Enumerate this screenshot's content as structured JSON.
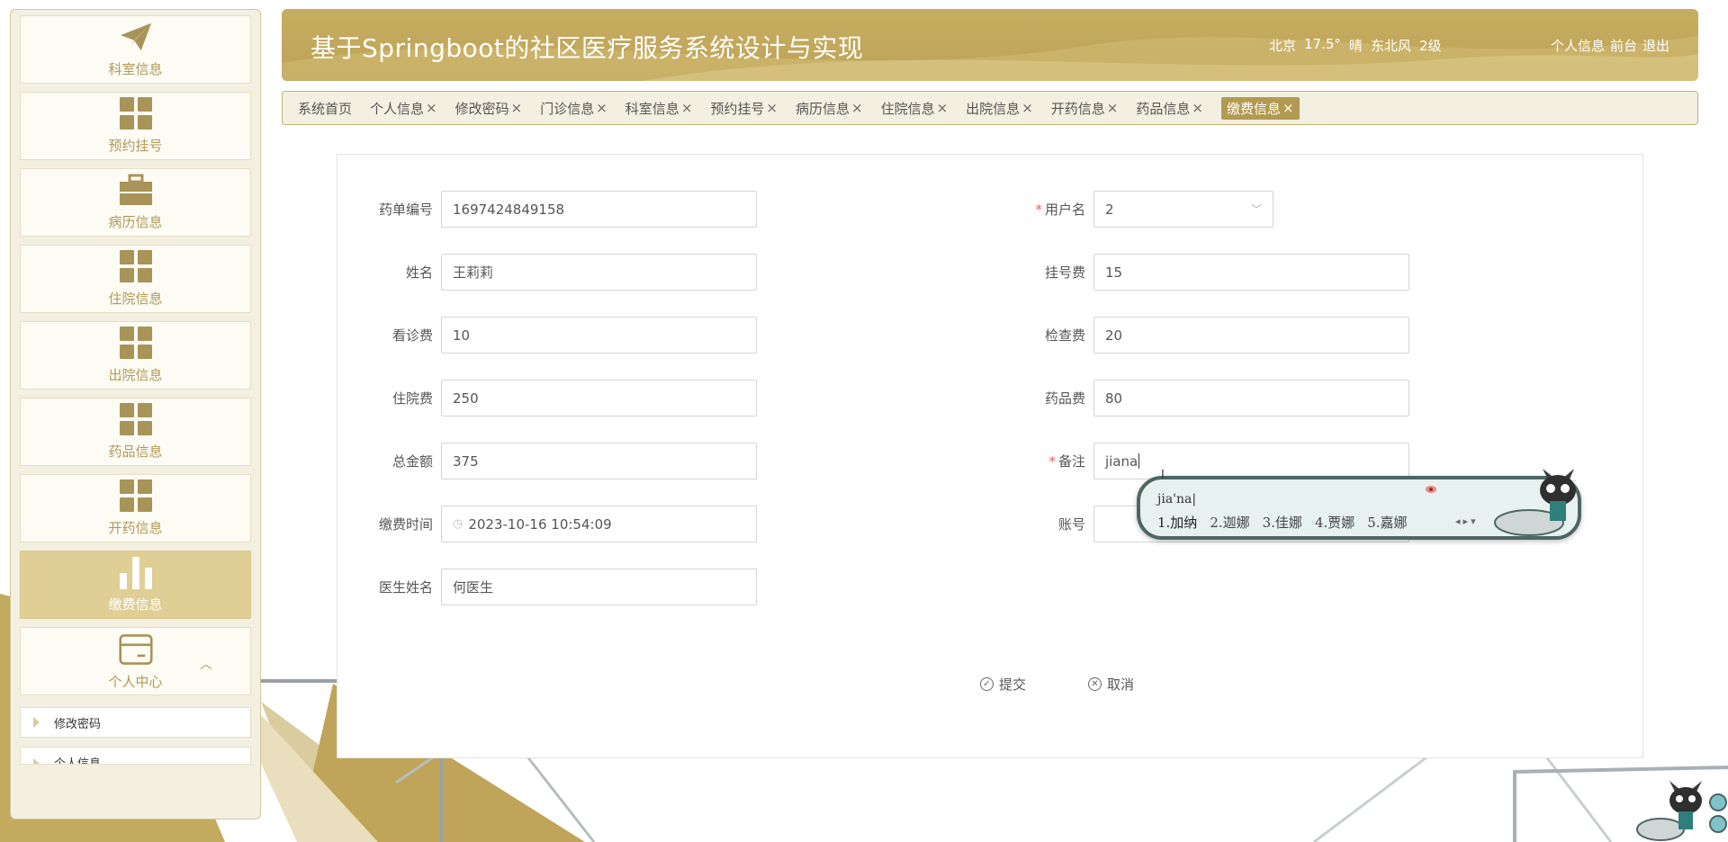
{
  "header": {
    "title": "基于Springboot的社区医疗服务系统设计与实现",
    "weather": [
      "北京",
      "17.5°",
      "晴",
      "东北风",
      "2级"
    ],
    "links": [
      "个人信息",
      "前台",
      "退出"
    ]
  },
  "sidebar": {
    "items": [
      {
        "label": "科室信息",
        "icon": "paper-plane-icon"
      },
      {
        "label": "预约挂号",
        "icon": "grid-icon"
      },
      {
        "label": "病历信息",
        "icon": "briefcase-icon"
      },
      {
        "label": "住院信息",
        "icon": "grid-icon"
      },
      {
        "label": "出院信息",
        "icon": "grid-icon"
      },
      {
        "label": "药品信息",
        "icon": "grid-icon"
      },
      {
        "label": "开药信息",
        "icon": "grid-icon"
      },
      {
        "label": "缴费信息",
        "icon": "bar-chart-icon"
      },
      {
        "label": "个人中心",
        "icon": "card-icon"
      }
    ],
    "submenu": [
      "修改密码",
      "个人信息"
    ]
  },
  "tabs": [
    {
      "label": "系统首页",
      "closable": false
    },
    {
      "label": "个人信息",
      "closable": true
    },
    {
      "label": "修改密码",
      "closable": true
    },
    {
      "label": "门诊信息",
      "closable": true
    },
    {
      "label": "科室信息",
      "closable": true
    },
    {
      "label": "预约挂号",
      "closable": true
    },
    {
      "label": "病历信息",
      "closable": true
    },
    {
      "label": "住院信息",
      "closable": true
    },
    {
      "label": "出院信息",
      "closable": true
    },
    {
      "label": "开药信息",
      "closable": true
    },
    {
      "label": "药品信息",
      "closable": true
    },
    {
      "label": "缴费信息",
      "closable": true,
      "active": true
    }
  ],
  "tab_close": "×",
  "form": {
    "left": [
      {
        "label": "药单编号",
        "value": "1697424849158"
      },
      {
        "label": "姓名",
        "value": "王莉莉"
      },
      {
        "label": "看诊费",
        "value": "10"
      },
      {
        "label": "住院费",
        "value": "250"
      },
      {
        "label": "总金额",
        "value": "375"
      },
      {
        "label": "缴费时间",
        "value": "2023-10-16 10:54:09"
      },
      {
        "label": "医生姓名",
        "value": "何医生"
      }
    ],
    "right": [
      {
        "label": "用户名",
        "value": "2",
        "required": true
      },
      {
        "label": "挂号费",
        "value": "15"
      },
      {
        "label": "检查费",
        "value": "20"
      },
      {
        "label": "药品费",
        "value": "80"
      },
      {
        "label": "备注",
        "value": "jiana",
        "required": true
      },
      {
        "label": "账号",
        "value": ""
      }
    ],
    "submit_label": "提交",
    "cancel_label": "取消"
  },
  "ime": {
    "composition": "jia'na",
    "candidates": [
      "1.加纳",
      "2.迦娜",
      "3.佳娜",
      "4.贾娜",
      "5.嘉娜"
    ]
  },
  "colors": {
    "accent": "#b29a52",
    "header": "#c3a95e",
    "sidebar_bg": "#f3efe1",
    "required": "#e56161"
  }
}
